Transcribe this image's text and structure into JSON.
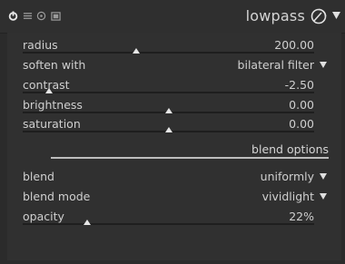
{
  "header": {
    "title": "lowpass",
    "icons": [
      "power-icon",
      "multi-instance-icon",
      "reset-icon",
      "presets-icon",
      "presets-wheel-icon",
      "menu-arrow-icon"
    ]
  },
  "params": {
    "radius": {
      "label": "radius",
      "value": "200.00",
      "fraction": 0.39
    },
    "soften_with": {
      "label": "soften with",
      "value": "bilateral filter"
    },
    "contrast": {
      "label": "contrast",
      "value": "-2.50",
      "fraction": 0.09
    },
    "brightness": {
      "label": "brightness",
      "value": "0.00",
      "fraction": 0.5
    },
    "saturation": {
      "label": "saturation",
      "value": "0.00",
      "fraction": 0.5
    }
  },
  "blend_section": {
    "title": "blend options",
    "blend": {
      "label": "blend",
      "value": "uniformly"
    },
    "blend_mode": {
      "label": "blend mode",
      "value": "vividlight"
    },
    "opacity": {
      "label": "opacity",
      "value": "22%",
      "fraction": 0.22
    }
  },
  "colors": {
    "background": "#2b2b2b",
    "panel": "#303030",
    "text": "#cfcfcf",
    "knob": "#e6e6e6"
  }
}
